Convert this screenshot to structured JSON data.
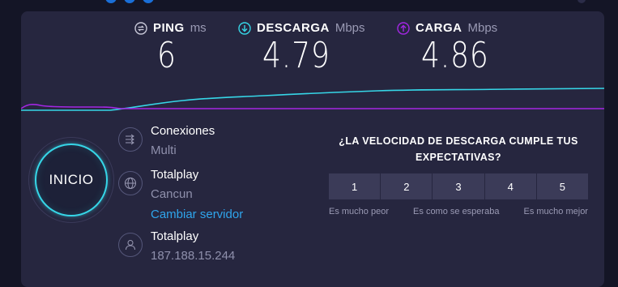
{
  "metrics": {
    "ping": {
      "label": "PING",
      "unit": "ms",
      "value": "6"
    },
    "download": {
      "label": "DESCARGA",
      "unit": "Mbps",
      "value": "4.79"
    },
    "upload": {
      "label": "CARGA",
      "unit": "Mbps",
      "value": "4.86"
    }
  },
  "colors": {
    "download": "#36d6e7",
    "upload": "#a326e3",
    "link": "#2fa5ec"
  },
  "start_button": {
    "label": "INICIO"
  },
  "connections": {
    "title": "Conexiones",
    "value": "Multi",
    "icon": "arrows-icon"
  },
  "server": {
    "isp": "Totalplay",
    "location": "Cancun",
    "change_label": "Cambiar servidor",
    "icon": "globe-icon"
  },
  "client": {
    "isp": "Totalplay",
    "ip": "187.188.15.244",
    "icon": "user-icon"
  },
  "survey": {
    "question": "¿LA VELOCIDAD DE DESCARGA CUMPLE TUS EXPECTATIVAS?",
    "options": [
      "1",
      "2",
      "3",
      "4",
      "5"
    ],
    "low_label": "Es mucho peor",
    "mid_label": "Es como se esperaba",
    "high_label": "Es mucho mejor"
  }
}
